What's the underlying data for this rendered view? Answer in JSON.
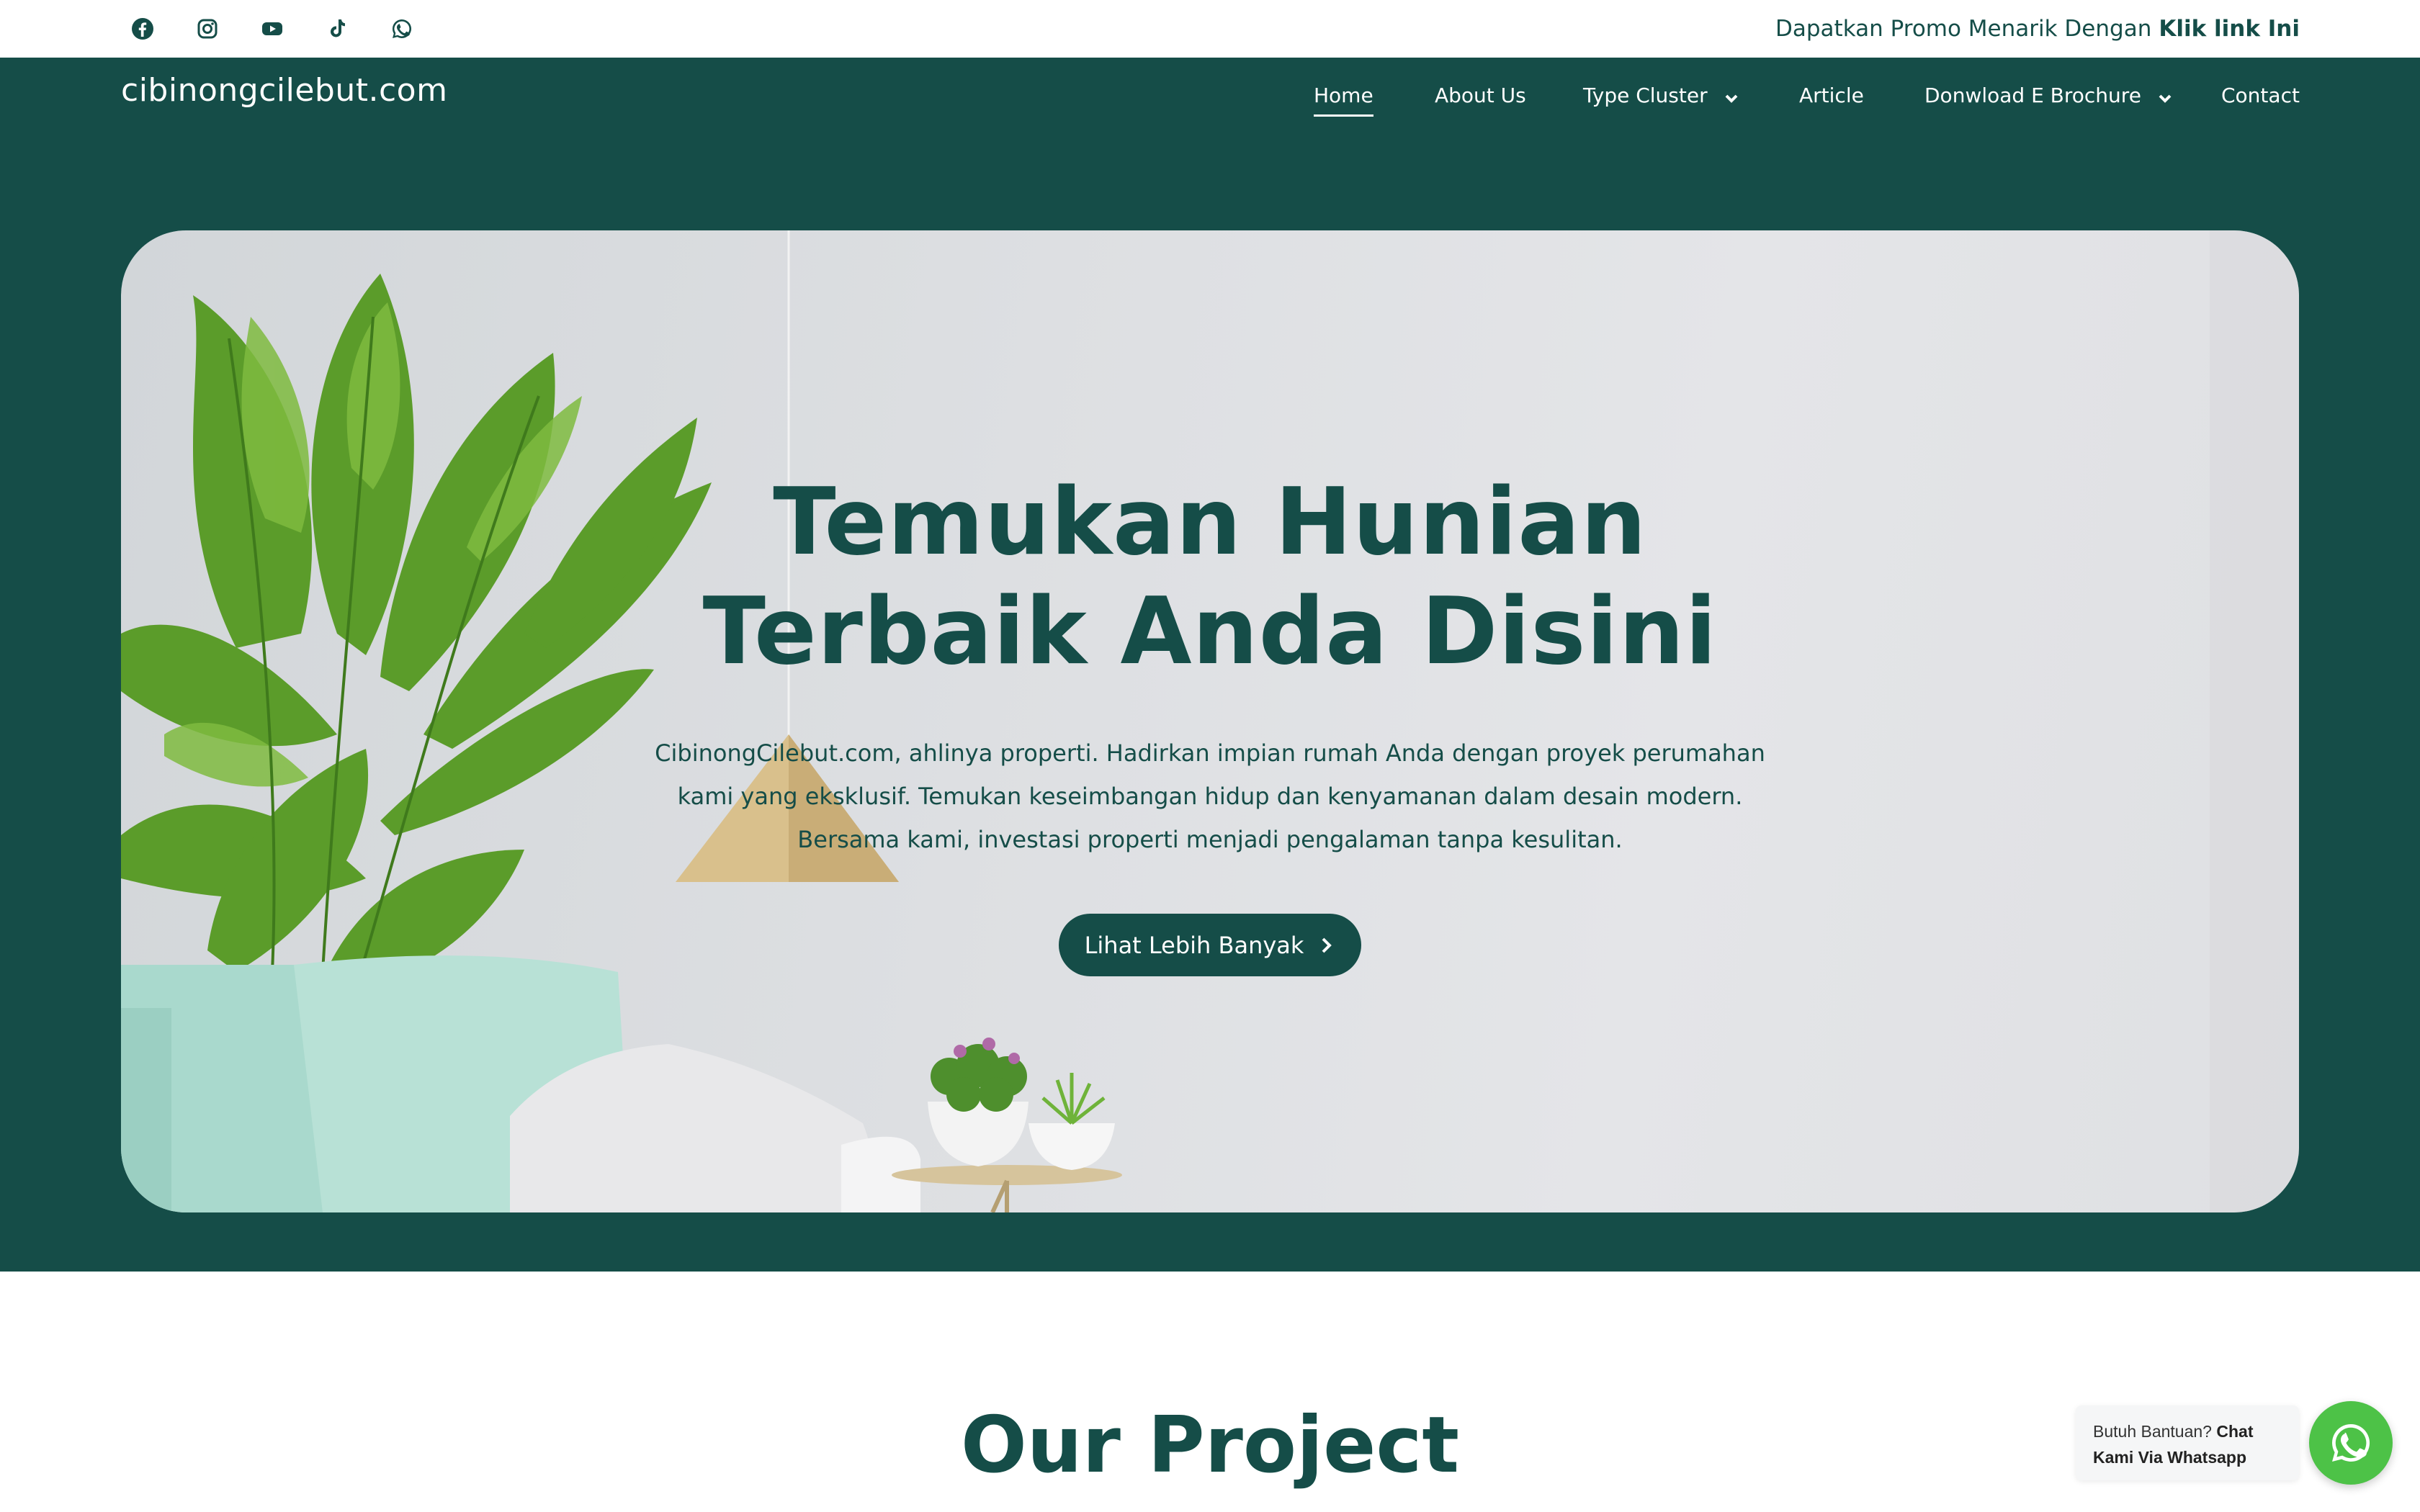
{
  "topbar": {
    "social_icons": [
      "facebook-icon",
      "instagram-icon",
      "youtube-icon",
      "tiktok-icon",
      "whatsapp-icon"
    ],
    "promo_text": "Dapatkan Promo Menarik Dengan",
    "promo_link": "Klik link Ini"
  },
  "header": {
    "logo": "cibinongcilebut.com",
    "nav": [
      {
        "label": "Home",
        "active": true
      },
      {
        "label": "About Us"
      },
      {
        "label": "Type Cluster",
        "dropdown": true
      },
      {
        "label": "Article"
      },
      {
        "label": "Donwload E Brochure",
        "dropdown": true
      },
      {
        "label": "Contact"
      }
    ]
  },
  "hero": {
    "title_line1": "Temukan Hunian",
    "title_line2": "Terbaik Anda Disini",
    "desc_line1": "CibinongCilebut.com, ahlinya properti. Hadirkan impian rumah Anda dengan proyek perumahan",
    "desc_line2": "kami yang eksklusif. Temukan keseimbangan hidup dan kenyamanan dalam desain modern.",
    "desc_line3": "Bersama kami, investasi properti menjadi pengalaman tanpa kesulitan.",
    "button_label": "Lihat Lebih Banyak"
  },
  "project": {
    "title": "Our Project"
  },
  "whatsapp_widget": {
    "text_prefix": "Butuh Bantuan?",
    "text_bold_1": "Chat",
    "text_bold_2": "Kami Via Whatsapp"
  },
  "colors": {
    "primary": "#154d48",
    "whatsapp": "#4dc247",
    "white": "#ffffff"
  }
}
